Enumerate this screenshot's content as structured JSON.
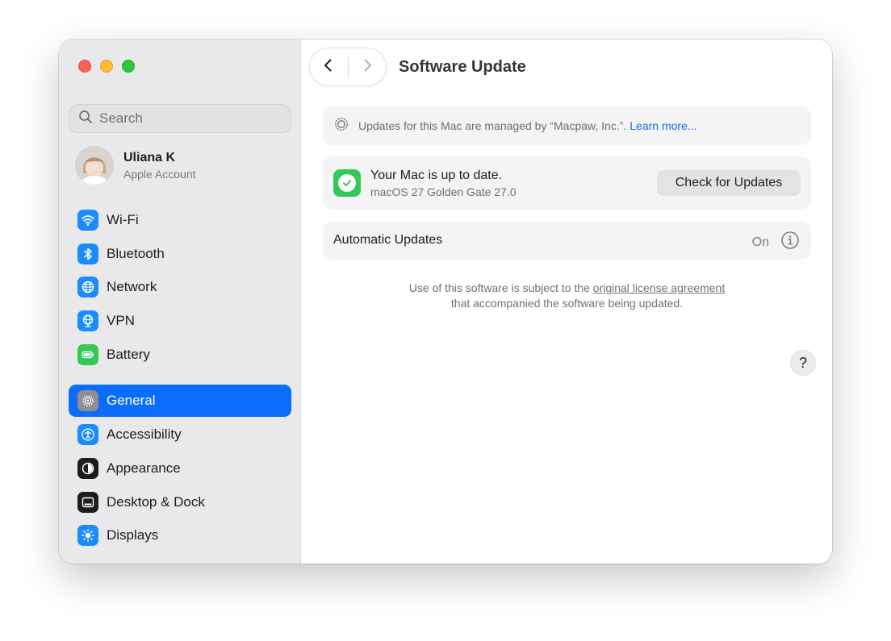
{
  "window": {
    "title": "Software Update"
  },
  "search": {
    "placeholder": "Search"
  },
  "account": {
    "name": "Uliana K",
    "subtitle": "Apple Account"
  },
  "sidebar": {
    "items": [
      {
        "label": "Wi-Fi",
        "icon": "wifi-icon",
        "color": "#1a8cff"
      },
      {
        "label": "Bluetooth",
        "icon": "bluetooth-icon",
        "color": "#1a8cff"
      },
      {
        "label": "Network",
        "icon": "globe-icon",
        "color": "#1a8cff"
      },
      {
        "label": "VPN",
        "icon": "vpn-globe-icon",
        "color": "#1a8cff"
      },
      {
        "label": "Battery",
        "icon": "battery-icon",
        "color": "#34c759"
      },
      {
        "label": "General",
        "icon": "gear-icon",
        "color": "#8e8e93",
        "selected": true
      },
      {
        "label": "Accessibility",
        "icon": "accessibility-icon",
        "color": "#1a8cff"
      },
      {
        "label": "Appearance",
        "icon": "appearance-icon",
        "color": "#1d1d1f"
      },
      {
        "label": "Desktop & Dock",
        "icon": "dock-icon",
        "color": "#1d1d1f"
      },
      {
        "label": "Displays",
        "icon": "sun-icon",
        "color": "#1a8cff"
      }
    ]
  },
  "managed": {
    "text": "Updates for this Mac are managed by “Macpaw, Inc.”.",
    "link": "Learn more..."
  },
  "status": {
    "title": "Your Mac is up to date.",
    "subtitle": "macOS 27 Golden Gate 27.0",
    "button": "Check for Updates"
  },
  "auto_updates": {
    "label": "Automatic Updates",
    "value": "On"
  },
  "license": {
    "prefix": "Use of this software is subject to the ",
    "link": "original license agreement",
    "suffix": "that accompanied the software being updated."
  },
  "help": {
    "label": "?"
  },
  "colors": {
    "accent": "#0a6dfe",
    "success": "#34c759"
  }
}
